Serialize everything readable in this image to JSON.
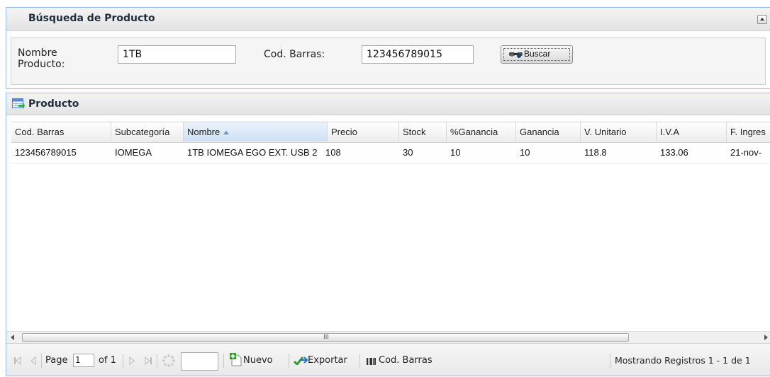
{
  "search": {
    "title": "Búsqueda de Producto",
    "nombre_label_line1": "Nombre",
    "nombre_label_line2": "Producto:",
    "nombre_value": "1TB",
    "codbarras_label": "Cod. Barras:",
    "codbarras_value": "123456789015",
    "buscar_label": "Buscar"
  },
  "grid": {
    "title": "Producto",
    "columns": [
      "Cod. Barras",
      "Subcategoría",
      "Nombre",
      "Precio",
      "Stock",
      "%Ganancia",
      "Ganancia",
      "V. Unitario",
      "I.V.A",
      "F. Ingres"
    ],
    "sorted_column": "Nombre",
    "rows": [
      [
        "123456789015",
        "IOMEGA",
        "1TB IOMEGA EGO EXT. USB 2",
        "108",
        "30",
        "10",
        "10",
        "118.8",
        "133.06",
        "21-nov-"
      ]
    ]
  },
  "scroll_grip": "III",
  "pager": {
    "page_label": "Page",
    "page_value": "1",
    "of_label": "of 1",
    "nuevo_label": "Nuevo",
    "exportar_label": "Exportar",
    "codbarras_label": "Cod. Barras",
    "status": "Mostrando Registros 1 - 1 de 1"
  },
  "colors": {
    "panel_border": "#99bbe8",
    "sorted_header": "#cfe0f5"
  }
}
